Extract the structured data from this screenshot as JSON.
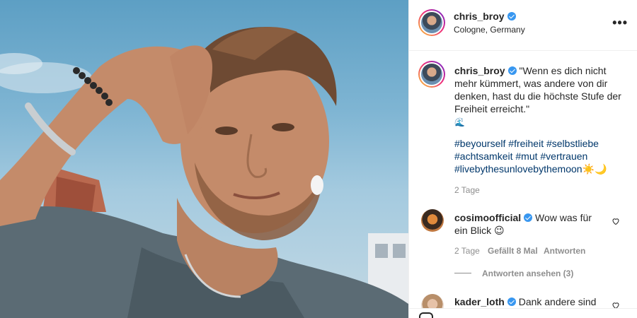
{
  "post": {
    "username": "chris_broy",
    "location": "Cologne, Germany",
    "more_label": "•••",
    "caption_text": "\"Wenn es dich nicht mehr kümmert, was andere von dir denken, hast du die höchste Stufe der Freiheit erreicht.\"",
    "caption_emoji": "🌊",
    "hashtags": [
      "#beyourself",
      "#freiheit",
      "#selbstliebe",
      "#achtsamkeit",
      "#mut",
      "#vertrauen",
      "#livebythesunlovebythemoon☀️🌙"
    ],
    "timestamp": "2 Tage"
  },
  "comments": [
    {
      "username": "cosimoofficial",
      "text": "Wow was für ein Blick 😉",
      "time": "2 Tage",
      "likes": "Gefällt 8 Mal",
      "reply_label": "Antworten",
      "view_replies": "Antworten ansehen (3)"
    },
    {
      "username": "kader_loth",
      "text": "Dank andere sind"
    }
  ],
  "colors": {
    "verified": "#3897f0",
    "hashtag": "#00376b",
    "meta": "#8e8e8e",
    "text": "#262626"
  },
  "icons": [
    "verified-icon",
    "more-options-icon",
    "heart-icon",
    "heart-icon",
    "like-icon"
  ]
}
